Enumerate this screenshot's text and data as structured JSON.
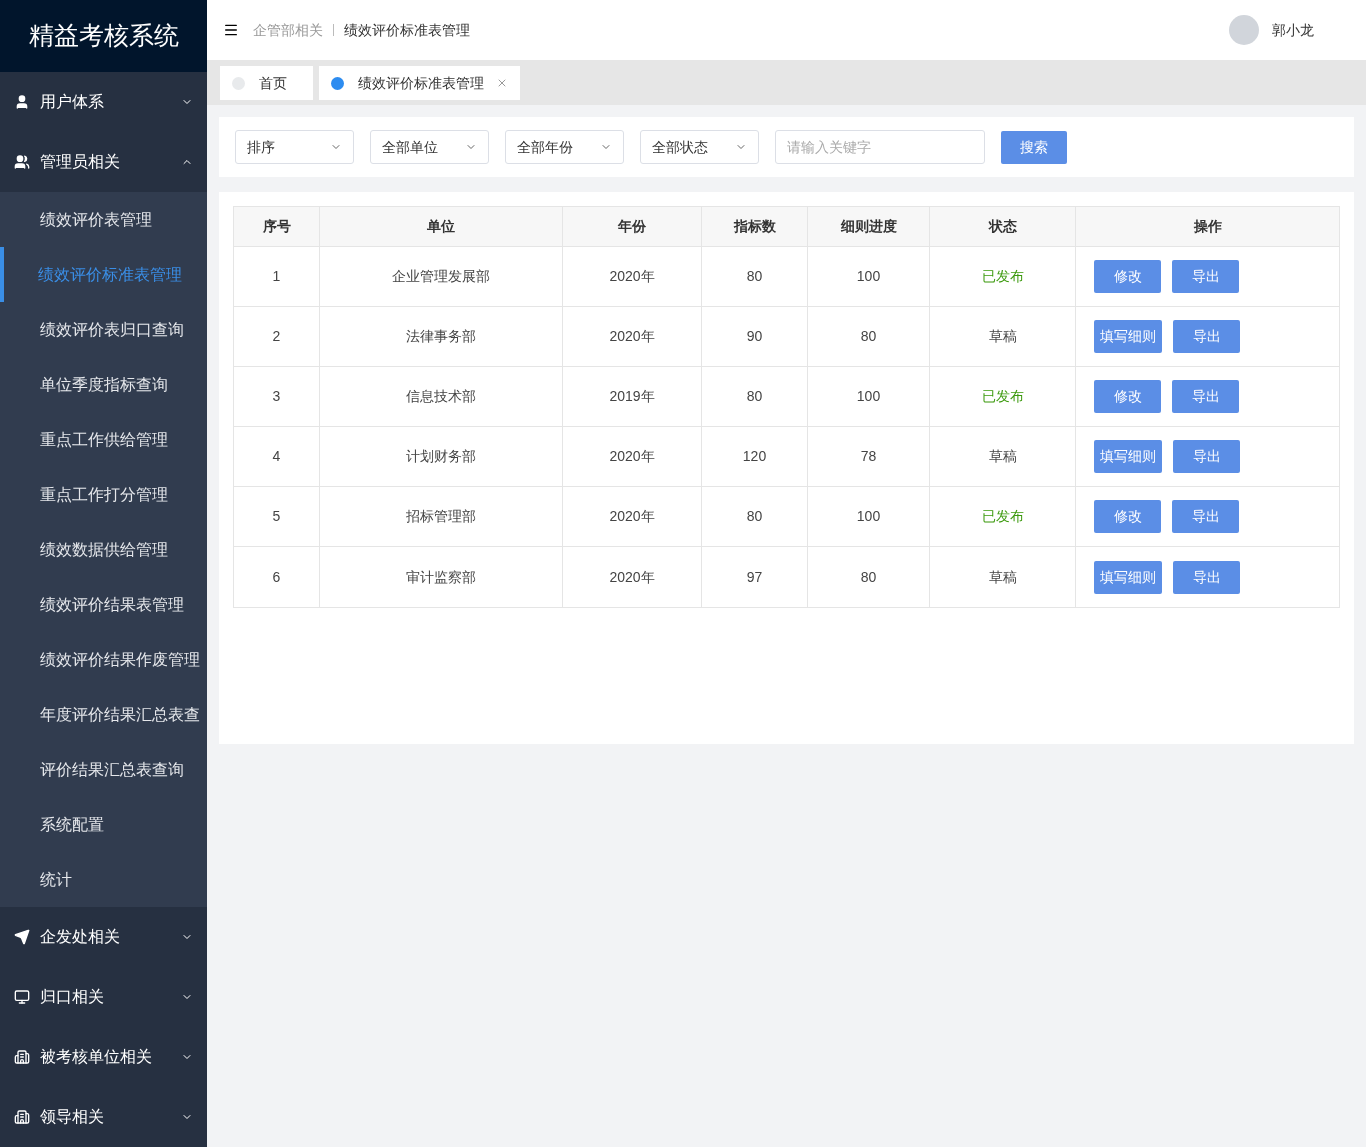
{
  "app_title": "精益考核系统",
  "sidebar": {
    "groups": [
      {
        "label": "用户体系",
        "expanded": false
      },
      {
        "label": "管理员相关",
        "expanded": true,
        "children": [
          {
            "label": "绩效评价表管理",
            "selected": false
          },
          {
            "label": "绩效评价标准表管理",
            "selected": true
          },
          {
            "label": "绩效评价表归口查询",
            "selected": false
          },
          {
            "label": "单位季度指标查询",
            "selected": false
          },
          {
            "label": "重点工作供给管理",
            "selected": false
          },
          {
            "label": "重点工作打分管理",
            "selected": false
          },
          {
            "label": "绩效数据供给管理",
            "selected": false
          },
          {
            "label": "绩效评价结果表管理",
            "selected": false
          },
          {
            "label": "绩效评价结果作废管理",
            "selected": false
          },
          {
            "label": "年度评价结果汇总表查",
            "selected": false
          },
          {
            "label": "评价结果汇总表查询",
            "selected": false
          },
          {
            "label": "系统配置",
            "selected": false
          },
          {
            "label": "统计",
            "selected": false
          }
        ]
      },
      {
        "label": "企发处相关",
        "expanded": false
      },
      {
        "label": "归口相关",
        "expanded": false
      },
      {
        "label": "被考核单位相关",
        "expanded": false
      },
      {
        "label": "领导相关",
        "expanded": false
      }
    ]
  },
  "breadcrumb": [
    "企管部相关",
    "绩效评价标准表管理"
  ],
  "user": {
    "name": "郭小龙"
  },
  "tabs": [
    {
      "label": "首页",
      "selected": false,
      "closable": false
    },
    {
      "label": "绩效评价标准表管理",
      "selected": true,
      "closable": true
    }
  ],
  "filters": {
    "selects": [
      "排序",
      "全部单位",
      "全部年份",
      "全部状态"
    ],
    "search": {
      "placeholder": "请输入关键字"
    },
    "search_button": "搜索"
  },
  "table": {
    "columns": [
      "序号",
      "单位",
      "年份",
      "指标数",
      "细则进度",
      "状态",
      "操作"
    ],
    "rows": [
      {
        "cells": [
          "1",
          "企业管理发展部",
          "2020年",
          "80",
          "100"
        ],
        "status": {
          "text": "已发布",
          "kind": "published"
        },
        "actions": [
          "修改",
          "导出"
        ]
      },
      {
        "cells": [
          "2",
          "法律事务部",
          "2020年",
          "90",
          "80"
        ],
        "status": {
          "text": "草稿",
          "kind": "draft"
        },
        "actions": [
          "填写细则",
          "导出"
        ]
      },
      {
        "cells": [
          "3",
          "信息技术部",
          "2019年",
          "80",
          "100"
        ],
        "status": {
          "text": "已发布",
          "kind": "published"
        },
        "actions": [
          "修改",
          "导出"
        ]
      },
      {
        "cells": [
          "4",
          "计划财务部",
          "2020年",
          "120",
          "78"
        ],
        "status": {
          "text": "草稿",
          "kind": "draft"
        },
        "actions": [
          "填写细则",
          "导出"
        ]
      },
      {
        "cells": [
          "5",
          "招标管理部",
          "2020年",
          "80",
          "100"
        ],
        "status": {
          "text": "已发布",
          "kind": "published"
        },
        "actions": [
          "修改",
          "导出"
        ]
      },
      {
        "cells": [
          "6",
          "审计监察部",
          "2020年",
          "97",
          "80"
        ],
        "status": {
          "text": "草稿",
          "kind": "draft"
        },
        "actions": [
          "填写细则",
          "导出"
        ]
      }
    ]
  }
}
